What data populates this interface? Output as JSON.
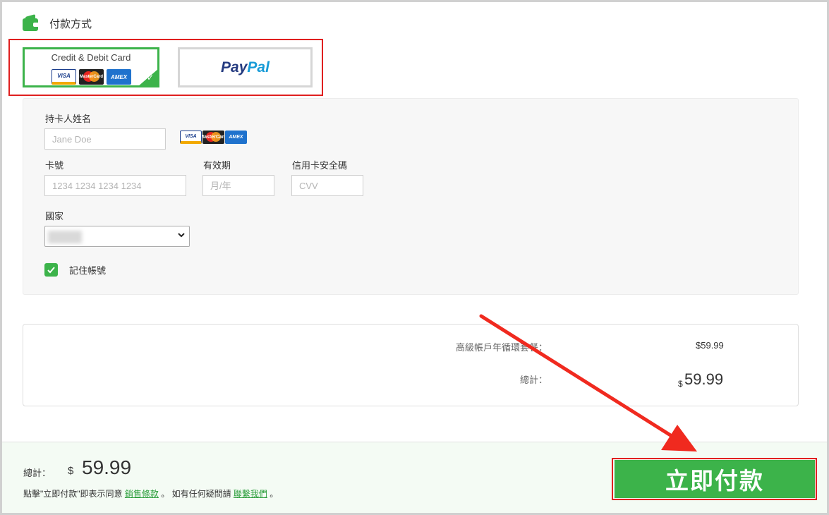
{
  "payment_method": {
    "title": "付款方式",
    "card_option_label": "Credit & Debit Card",
    "card_logos": [
      "VISA",
      "MasterCard",
      "AMEX"
    ],
    "paypal_pay": "Pay",
    "paypal_pal": "Pal"
  },
  "form": {
    "cardholder_label": "持卡人姓名",
    "cardholder_placeholder": "Jane Doe",
    "card_number_label": "卡號",
    "card_number_placeholder": "1234 1234 1234 1234",
    "expiry_label": "有效期",
    "expiry_placeholder": "月/年",
    "cvv_label": "信用卡安全碼",
    "cvv_placeholder": "CVV",
    "country_label": "國家",
    "remember_label": "記住帳號",
    "remember_checked": true
  },
  "summary": {
    "plan_label": "高級帳戶年循環套餐：",
    "plan_price": "$59.99",
    "total_label": "總計：",
    "total_currency": "$",
    "total_amount": "59.99"
  },
  "footer": {
    "total_label": "總計：",
    "currency": "$",
    "amount": "59.99",
    "note_prefix": "點擊\"立即付款\"即表示同意",
    "terms_link": "銷售條款",
    "note_middle": "。 如有任何疑問請",
    "contact_link": "聯繫我們",
    "note_suffix": "。",
    "pay_button": "立即付款"
  },
  "colors": {
    "accent_green": "#3cb34a",
    "annotation_red": "#e02020"
  }
}
